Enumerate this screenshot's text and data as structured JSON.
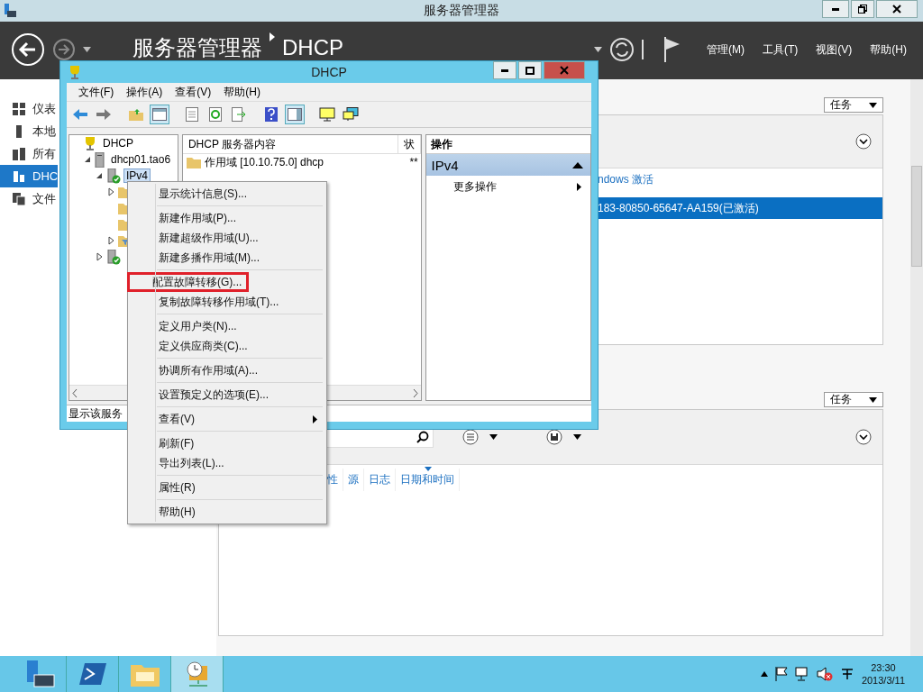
{
  "window": {
    "title": "服务器管理器"
  },
  "header": {
    "breadcrumb": [
      "服务器管理器",
      "DHCP"
    ],
    "menus": [
      "管理(M)",
      "工具(T)",
      "视图(V)",
      "帮助(H)"
    ]
  },
  "sidebar": {
    "items": [
      {
        "label": "仪表",
        "kind": "dashboard",
        "selected": false
      },
      {
        "label": "本地",
        "kind": "server",
        "selected": false
      },
      {
        "label": "所有",
        "kind": "servers",
        "selected": false
      },
      {
        "label": "DHC",
        "kind": "dhcp",
        "selected": true
      },
      {
        "label": "文件",
        "kind": "files",
        "selected": false
      }
    ]
  },
  "activation_panel": {
    "tasks_button": "任务",
    "rows": [
      {
        "text": "ndows 激活",
        "selected": false
      },
      {
        "text": "183-80850-65647-AA159(已激活)",
        "selected": true
      }
    ]
  },
  "events_panel": {
    "tasks_button": "任务",
    "columns": [
      {
        "label": "性",
        "sorted": false
      },
      {
        "label": "源",
        "sorted": false
      },
      {
        "label": "日志",
        "sorted": false
      },
      {
        "label": "日期和时间",
        "sorted": true
      }
    ]
  },
  "dhcp_window": {
    "title": "DHCP",
    "menus": [
      "文件(F)",
      "操作(A)",
      "查看(V)",
      "帮助(H)"
    ],
    "tree": [
      {
        "label": "DHCP",
        "kind": "root",
        "selected": false,
        "children": [
          {
            "label": "dhcp01.tao6",
            "kind": "server",
            "expanded": true,
            "selected": false,
            "children": [
              {
                "label": "IPv4",
                "kind": "protocol",
                "expanded": true,
                "selected": true,
                "children": [
                  {
                    "kind": "folder",
                    "expanded": false
                  },
                  {
                    "kind": "folder"
                  },
                  {
                    "kind": "folder"
                  },
                  {
                    "kind": "filter",
                    "expanded": false
                  }
                ]
              },
              {
                "kind": "protocol",
                "expanded": false
              }
            ]
          }
        ]
      }
    ],
    "list": {
      "columns": [
        "DHCP 服务器内容",
        "状"
      ],
      "rows": [
        {
          "name": "作用域 [10.10.75.0] dhcp",
          "status": "**"
        }
      ]
    },
    "actions": {
      "header": "操作",
      "sections": [
        {
          "title": "IPv4",
          "expanded": true,
          "items": [
            {
              "label": "更多操作",
              "submenu": true
            }
          ]
        }
      ]
    },
    "status_bar": "显示该服务"
  },
  "context_menu": [
    [
      {
        "label": "显示统计信息(S)...",
        "highlighted": false
      }
    ],
    [
      {
        "label": "新建作用域(P)...",
        "highlighted": false
      },
      {
        "label": "新建超级作用域(U)...",
        "highlighted": false
      },
      {
        "label": "新建多播作用域(M)...",
        "highlighted": false
      }
    ],
    [
      {
        "label": "配置故障转移(G)...",
        "highlighted": true
      },
      {
        "label": "复制故障转移作用域(T)...",
        "highlighted": false
      }
    ],
    [
      {
        "label": "定义用户类(N)...",
        "highlighted": false
      },
      {
        "label": "定义供应商类(C)...",
        "highlighted": false
      }
    ],
    [
      {
        "label": "协调所有作用域(A)...",
        "highlighted": false
      }
    ],
    [
      {
        "label": "设置预定义的选项(E)...",
        "highlighted": false
      }
    ],
    [
      {
        "label": "查看(V)",
        "highlighted": false,
        "submenu": true
      }
    ],
    [
      {
        "label": "刷新(F)",
        "highlighted": false
      },
      {
        "label": "导出列表(L)...",
        "highlighted": false
      }
    ],
    [
      {
        "label": "属性(R)",
        "highlighted": false
      }
    ],
    [
      {
        "label": "帮助(H)",
        "highlighted": false
      }
    ]
  ],
  "taskbar": {
    "apps": [
      {
        "kind": "server-manager",
        "selected": false
      },
      {
        "kind": "powershell",
        "selected": false
      },
      {
        "kind": "explorer",
        "selected": false
      },
      {
        "kind": "dhcp",
        "selected": true
      }
    ],
    "clock": {
      "time": "23:30",
      "date": "2013/3/11"
    }
  }
}
